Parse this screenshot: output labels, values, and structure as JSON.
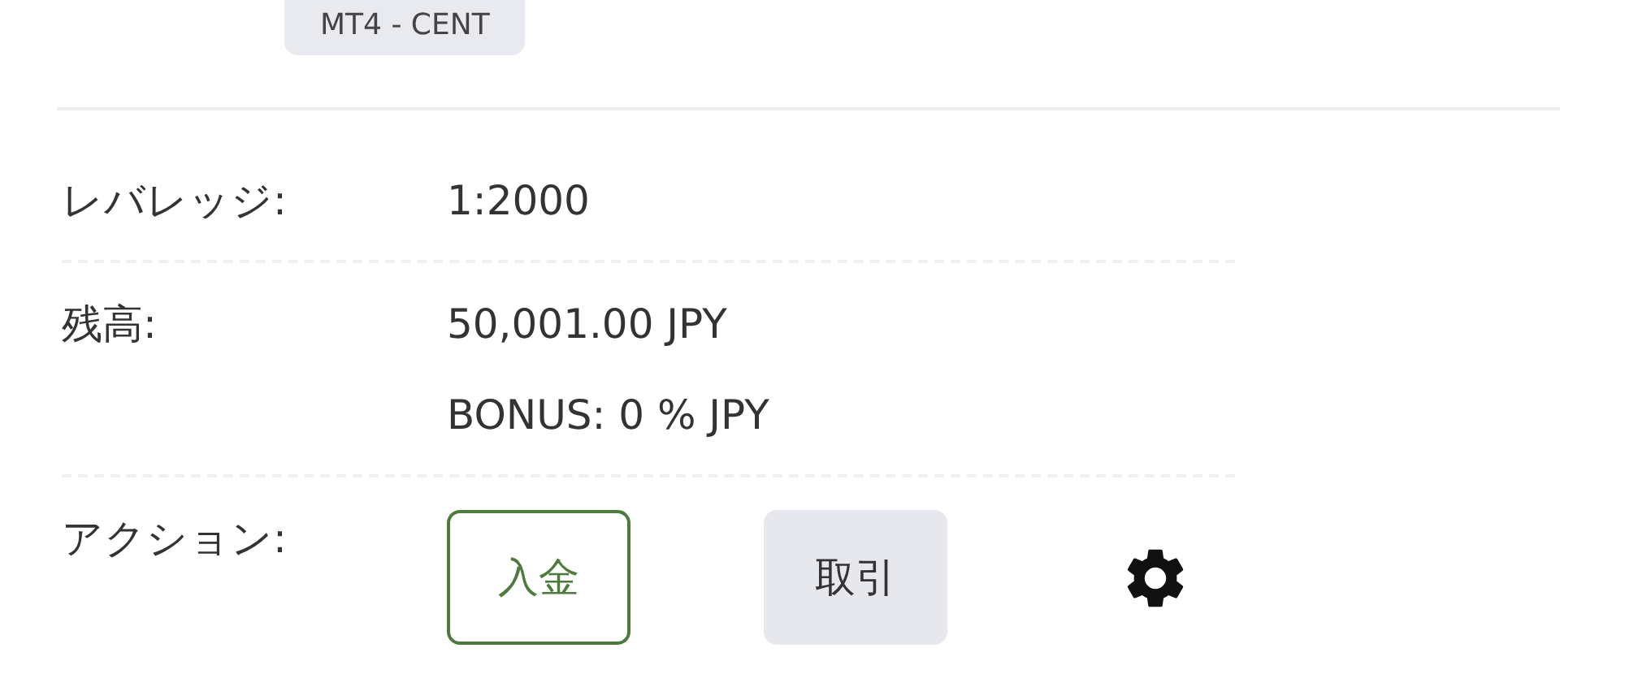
{
  "account_type_badge": "MT4 - CENT",
  "rows": [
    {
      "label": "レバレッジ:",
      "values": [
        "1:2000"
      ]
    },
    {
      "label": "残高:",
      "values": [
        "50,001.00 JPY",
        "BONUS: 0 % JPY"
      ]
    }
  ],
  "actions": {
    "label": "アクション:",
    "buttons": [
      {
        "label": "入金",
        "kind": "outline"
      },
      {
        "label": "取引",
        "kind": "filled"
      },
      {
        "kind": "settings"
      }
    ]
  }
}
